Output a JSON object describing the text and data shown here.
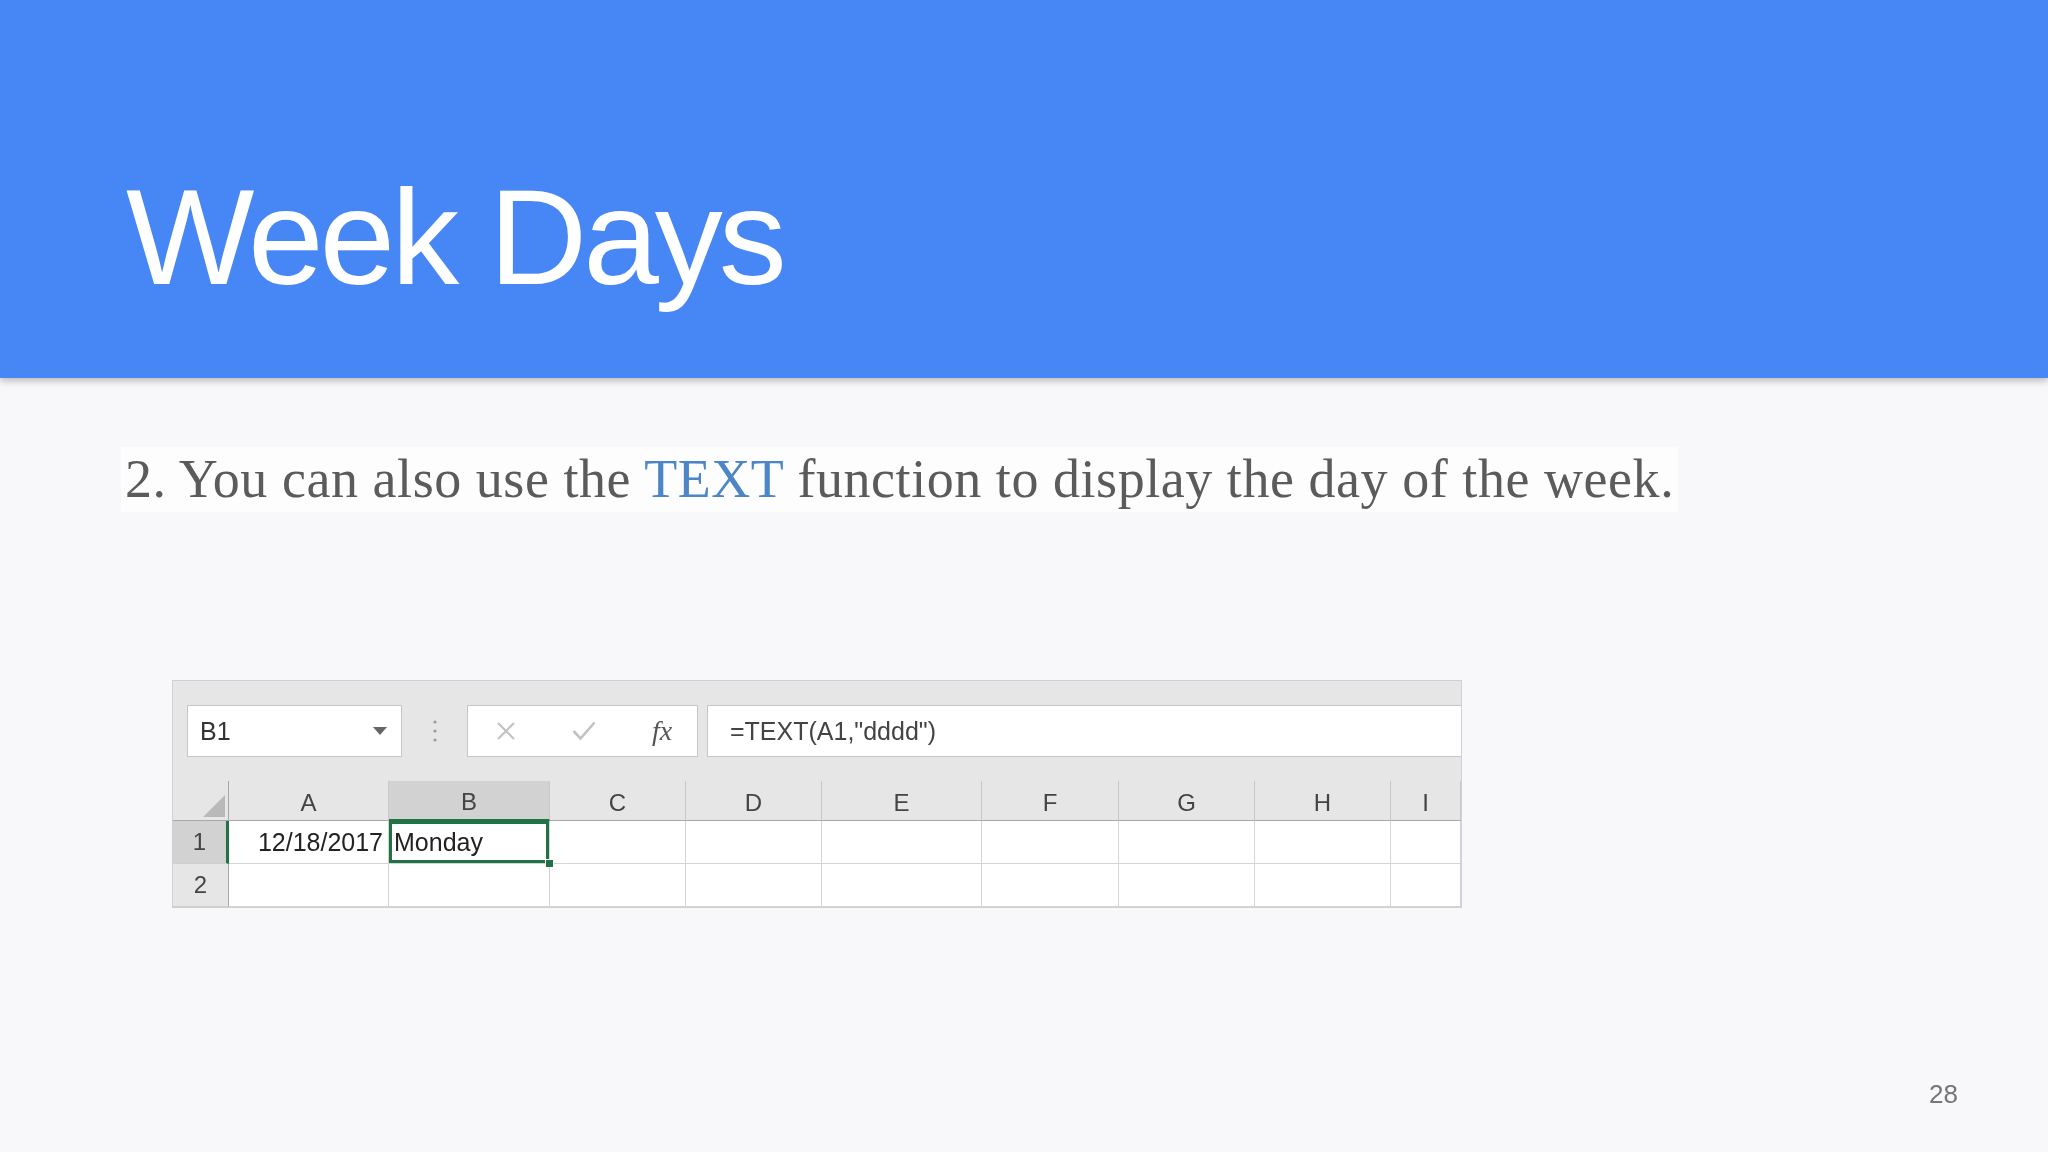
{
  "slide": {
    "title": "Week Days",
    "body_text": [
      {
        "kind": "plain",
        "text": "2. You can also use the "
      },
      {
        "kind": "highlight",
        "text": "TEXT"
      },
      {
        "kind": "plain",
        "text": " function to display the day of the week."
      }
    ],
    "page_number": "28"
  },
  "spreadsheet": {
    "name_box": {
      "value": "B1"
    },
    "formula_buttons": [
      {
        "kind": "cancel",
        "disabled": true
      },
      {
        "kind": "enter",
        "disabled": true
      },
      {
        "kind": "function",
        "label": "fx",
        "disabled": false
      }
    ],
    "formula_bar": {
      "value": "=TEXT(A1,\"dddd\")"
    },
    "columns": [
      {
        "label": "A",
        "selected": false
      },
      {
        "label": "B",
        "selected": true
      },
      {
        "label": "C",
        "selected": false
      },
      {
        "label": "D",
        "selected": false
      },
      {
        "label": "E",
        "selected": false
      },
      {
        "label": "F",
        "selected": false
      },
      {
        "label": "G",
        "selected": false
      },
      {
        "label": "H",
        "selected": false
      },
      {
        "label": "I",
        "selected": false
      }
    ],
    "rows": [
      {
        "label": "1",
        "selected": true,
        "cells": [
          {
            "kind": "date",
            "value": "12/18/2017",
            "selected": false
          },
          {
            "kind": "text",
            "value": "Monday",
            "selected": true
          },
          {
            "kind": "empty",
            "selected": false
          },
          {
            "kind": "empty",
            "selected": false
          },
          {
            "kind": "empty",
            "selected": false
          },
          {
            "kind": "empty",
            "selected": false
          },
          {
            "kind": "empty",
            "selected": false
          },
          {
            "kind": "empty",
            "selected": false
          },
          {
            "kind": "empty",
            "selected": false
          }
        ]
      },
      {
        "label": "2",
        "selected": false,
        "cells": [
          {
            "kind": "empty",
            "selected": false
          },
          {
            "kind": "empty",
            "selected": false
          },
          {
            "kind": "empty",
            "selected": false
          },
          {
            "kind": "empty",
            "selected": false
          },
          {
            "kind": "empty",
            "selected": false
          },
          {
            "kind": "empty",
            "selected": false
          },
          {
            "kind": "empty",
            "selected": false
          },
          {
            "kind": "empty",
            "selected": false
          },
          {
            "kind": "empty",
            "selected": false
          }
        ]
      }
    ]
  }
}
